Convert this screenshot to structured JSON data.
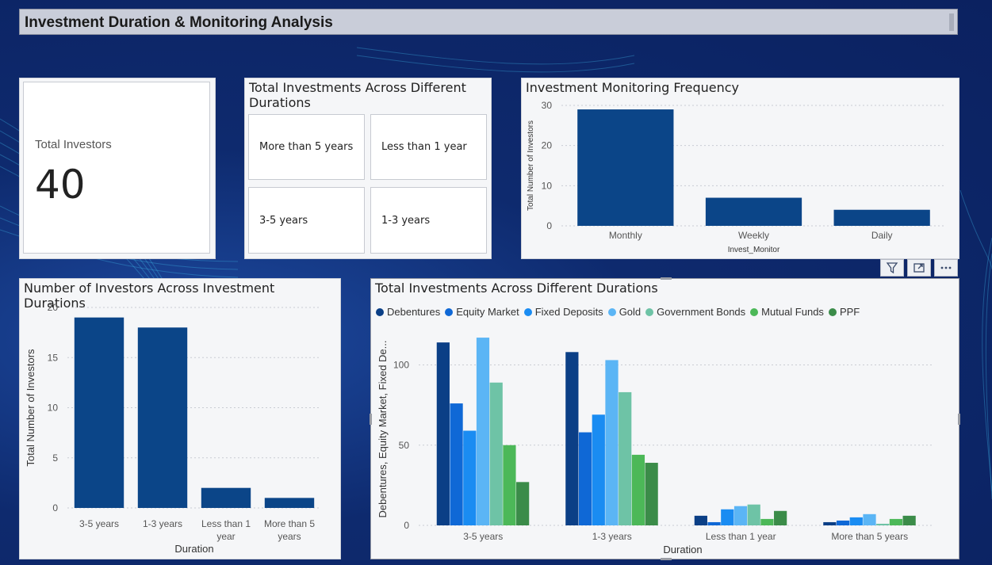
{
  "page": {
    "title": "Investment Duration & Monitoring Analysis"
  },
  "kpi": {
    "label": "Total Investors",
    "value": "40"
  },
  "slicer": {
    "title": "Total Investments Across Different Durations",
    "options": [
      "More than 5 years",
      "Less than 1 year",
      "3-5 years",
      "1-3 years"
    ]
  },
  "chart_data": [
    {
      "id": "monitoring",
      "type": "bar",
      "title": "Investment Monitoring Frequency",
      "categories": [
        "Monthly",
        "Weekly",
        "Daily"
      ],
      "values": [
        29,
        7,
        4
      ],
      "xlabel": "Invest_Monitor",
      "ylabel": "Total Number of Investors",
      "ylim": [
        0,
        30
      ],
      "yticks": [
        0,
        10,
        20,
        30
      ],
      "grid": true,
      "color": "#0b4588"
    },
    {
      "id": "durations",
      "type": "bar",
      "title": "Number of Investors Across Investment Durations",
      "categories": [
        "3-5 years",
        "1-3 years",
        "Less than 1 year",
        "More than 5 years"
      ],
      "values": [
        19,
        18,
        2,
        1
      ],
      "xlabel": "Duration",
      "ylabel": "Total Number of Investors",
      "ylim": [
        0,
        20
      ],
      "yticks": [
        0,
        5,
        10,
        15,
        20
      ],
      "grid": true,
      "color": "#0b4588"
    },
    {
      "id": "instruments",
      "type": "bar",
      "title": "Total Investments Across Different Durations",
      "categories": [
        "3-5 years",
        "1-3 years",
        "Less than 1 year",
        "More than 5 years"
      ],
      "xlabel": "Duration",
      "ylabel": "Debentures, Equity Market, Fixed De...",
      "ylim": [
        0,
        120
      ],
      "yticks": [
        0,
        50,
        100
      ],
      "grid": true,
      "legend": "top-left",
      "series": [
        {
          "name": "Debentures",
          "values": [
            114,
            108,
            6,
            2
          ],
          "color": "#0b3f86"
        },
        {
          "name": "Equity Market",
          "values": [
            76,
            58,
            2,
            3
          ],
          "color": "#0f68d6"
        },
        {
          "name": "Fixed Deposits",
          "values": [
            59,
            69,
            10,
            5
          ],
          "color": "#1a8cf2"
        },
        {
          "name": "Gold",
          "values": [
            117,
            103,
            12,
            7
          ],
          "color": "#5bb5f5"
        },
        {
          "name": "Government Bonds",
          "values": [
            89,
            83,
            13,
            1
          ],
          "color": "#6ec3a6"
        },
        {
          "name": "Mutual Funds",
          "values": [
            50,
            44,
            4,
            4
          ],
          "color": "#4cb858"
        },
        {
          "name": "PPF",
          "values": [
            27,
            39,
            9,
            6
          ],
          "color": "#3b8c49"
        }
      ]
    }
  ]
}
